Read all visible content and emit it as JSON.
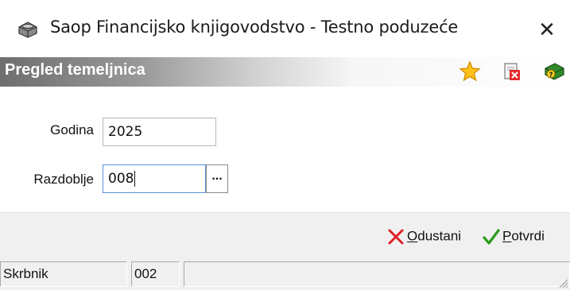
{
  "window": {
    "title": "Saop Financijsko knjigovodstvo - Testno poduzeće",
    "app_icon": "printer-icon",
    "close_glyph": "✕"
  },
  "header": {
    "title": "Pregled temeljnica",
    "icons": [
      "star-icon",
      "delete-document-icon",
      "help-book-icon"
    ]
  },
  "form": {
    "godina_label": "Godina",
    "godina_value": "2025",
    "razdoblje_label": "Razdoblje",
    "razdoblje_value": "008",
    "browse_label": "..."
  },
  "buttons": {
    "cancel_label": "Odustani",
    "confirm_label": "Potvrdi"
  },
  "status": {
    "cell1": "Skrbnik",
    "cell2": "002",
    "cell3": ""
  },
  "colors": {
    "cancel_x": "#e0202a",
    "confirm_check": "#2a9a1a",
    "header_gradient_start": "#6e6e6e"
  }
}
